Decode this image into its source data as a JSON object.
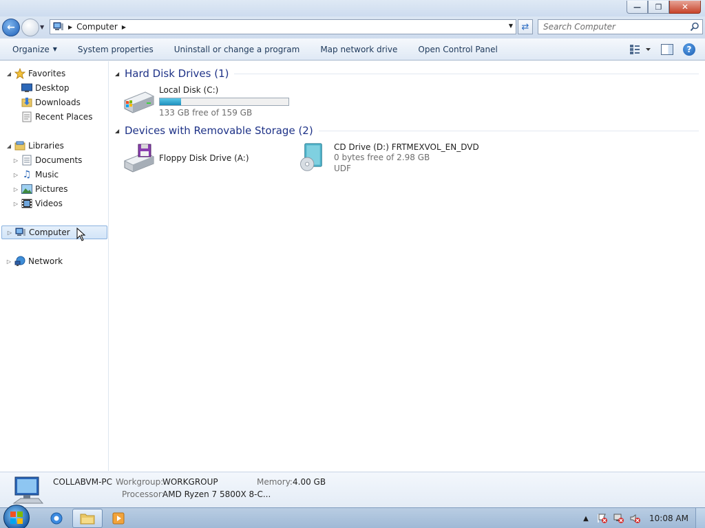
{
  "window": {
    "caption": {
      "minimize_icon": "minimize-icon",
      "restore_icon": "restore-icon",
      "close_icon": "close-icon"
    }
  },
  "navbar": {
    "breadcrumb": "Computer",
    "search_placeholder": "Search Computer"
  },
  "toolbar": {
    "organize": "Organize",
    "system_properties": "System properties",
    "uninstall": "Uninstall or change a program",
    "map_drive": "Map network drive",
    "control_panel": "Open Control Panel"
  },
  "navpane": {
    "favorites": "Favorites",
    "desktop": "Desktop",
    "downloads": "Downloads",
    "recent": "Recent Places",
    "libraries": "Libraries",
    "documents": "Documents",
    "music": "Music",
    "pictures": "Pictures",
    "videos": "Videos",
    "computer": "Computer",
    "network": "Network"
  },
  "content": {
    "hdd_group": "Hard Disk Drives (1)",
    "removable_group": "Devices with Removable Storage (2)",
    "local_disk": {
      "name": "Local Disk (C:)",
      "free": "133 GB free of 159 GB",
      "used_fraction": 0.164
    },
    "floppy": {
      "name": "Floppy Disk Drive (A:)"
    },
    "cd_drive": {
      "name": "CD Drive (D:) FRTMEXVOL_EN_DVD",
      "free": "0 bytes free of 2.98 GB",
      "fs": "UDF"
    }
  },
  "details": {
    "pc_name": "COLLABVM-PC",
    "workgroup_label": "Workgroup:",
    "workgroup": "WORKGROUP",
    "memory_label": "Memory:",
    "memory": "4.00 GB",
    "processor_label": "Processor:",
    "processor": "AMD Ryzen 7 5800X 8-C..."
  },
  "taskbar": {
    "clock": "10:08 AM"
  },
  "colors": {
    "accent": "#1e3287",
    "progress": "#1d8fbd"
  }
}
